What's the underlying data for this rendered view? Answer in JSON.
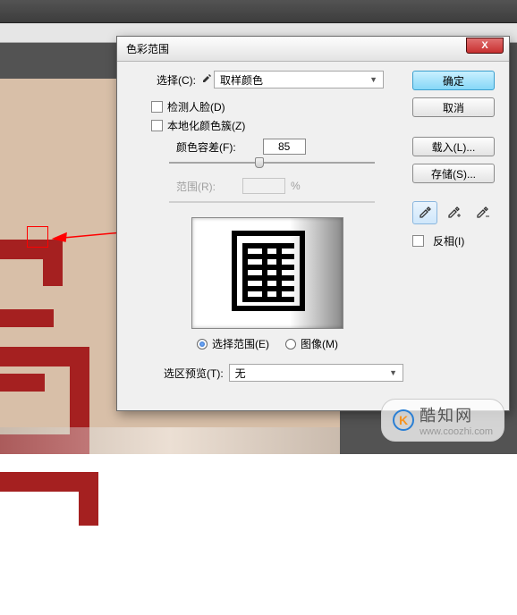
{
  "dialog": {
    "title": "色彩范围",
    "select_label": "选择(C):",
    "select_value": "取样颜色",
    "detect_faces": "检测人脸(D)",
    "local_clusters": "本地化颜色簇(Z)",
    "fuzziness_label": "颜色容差(F):",
    "fuzziness_value": "85",
    "range_label": "范围(R):",
    "range_unit": "%",
    "radio_selection": "选择范围(E)",
    "radio_image": "图像(M)",
    "selection_preview_label": "选区预览(T):",
    "selection_preview_value": "无"
  },
  "buttons": {
    "ok": "确定",
    "cancel": "取消",
    "load": "载入(L)...",
    "save": "存储(S)...",
    "invert": "反相(I)"
  },
  "icons": {
    "eyedropper": "eyedropper-icon",
    "eyedropper_plus": "eyedropper-plus-icon",
    "eyedropper_minus": "eyedropper-minus-icon"
  },
  "watermark": {
    "text": "酷知网",
    "url": "www.coozhi.com",
    "logo": "K"
  }
}
